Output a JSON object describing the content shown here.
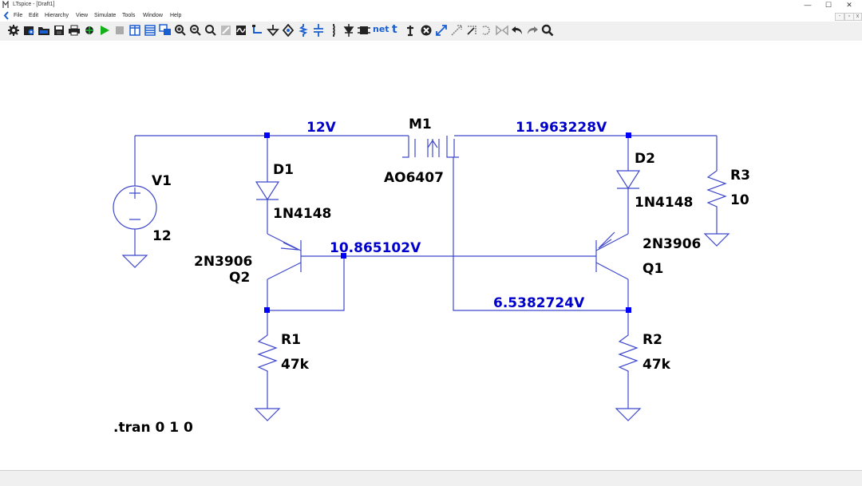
{
  "window": {
    "title": "LTspice - [Draft1]",
    "controls": [
      "—",
      "☐",
      "✕"
    ]
  },
  "menu": {
    "items": [
      "File",
      "Edit",
      "Hierarchy",
      "View",
      "Simulate",
      "Tools",
      "Window",
      "Help"
    ],
    "doc_controls": [
      "-",
      "▫",
      "x"
    ]
  },
  "toolbar": {
    "tools": [
      "settings-icon",
      "open-schematic-icon",
      "open-folder-icon",
      "save-icon",
      "print-icon",
      "control-panel-icon",
      "run-icon",
      "halt-icon",
      "tile-vertical-icon",
      "tile-horizontal-icon",
      "cascade-icon",
      "zoom-in-icon",
      "zoom-out-icon",
      "zoom-fit-icon",
      "zoom-full-icon",
      "autoscale-icon",
      "wire-icon",
      "ground-icon",
      "label-net-icon",
      "resistor-icon",
      "capacitor-icon",
      "inductor-icon",
      "diode-icon",
      "component-icon",
      "net-icon",
      "text-icon",
      "spice-directive-icon",
      "delete-icon",
      "move-icon",
      "drag-icon",
      "rotate-icon",
      "mirror-icon",
      "undo-icon",
      "redo-icon",
      "find-icon"
    ],
    "net_label": "net",
    "text_label": "t"
  },
  "schematic": {
    "components": {
      "v1": {
        "name": "V1",
        "value": "12"
      },
      "d1": {
        "name": "D1",
        "value": "1N4148"
      },
      "d2": {
        "name": "D2",
        "value": "1N4148"
      },
      "m1": {
        "name": "M1",
        "value": "AO6407"
      },
      "q2": {
        "name": "Q2",
        "value": "2N3906"
      },
      "q1": {
        "name": "Q1",
        "value": "2N3906"
      },
      "r1": {
        "name": "R1",
        "value": "47k"
      },
      "r2": {
        "name": "R2",
        "value": "47k"
      },
      "r3": {
        "name": "R3",
        "value": "10"
      }
    },
    "node_voltages": {
      "supply": "12V",
      "mosfet_drain": "11.963228V",
      "base_node": "10.865102V",
      "gate_node": "6.5382724V"
    },
    "directive": ".tran 0 1 0",
    "colors": {
      "wire": "#3f48cc",
      "node_label": "#0000cc",
      "junction": "#0000ff",
      "component": "#3f48cc"
    }
  }
}
